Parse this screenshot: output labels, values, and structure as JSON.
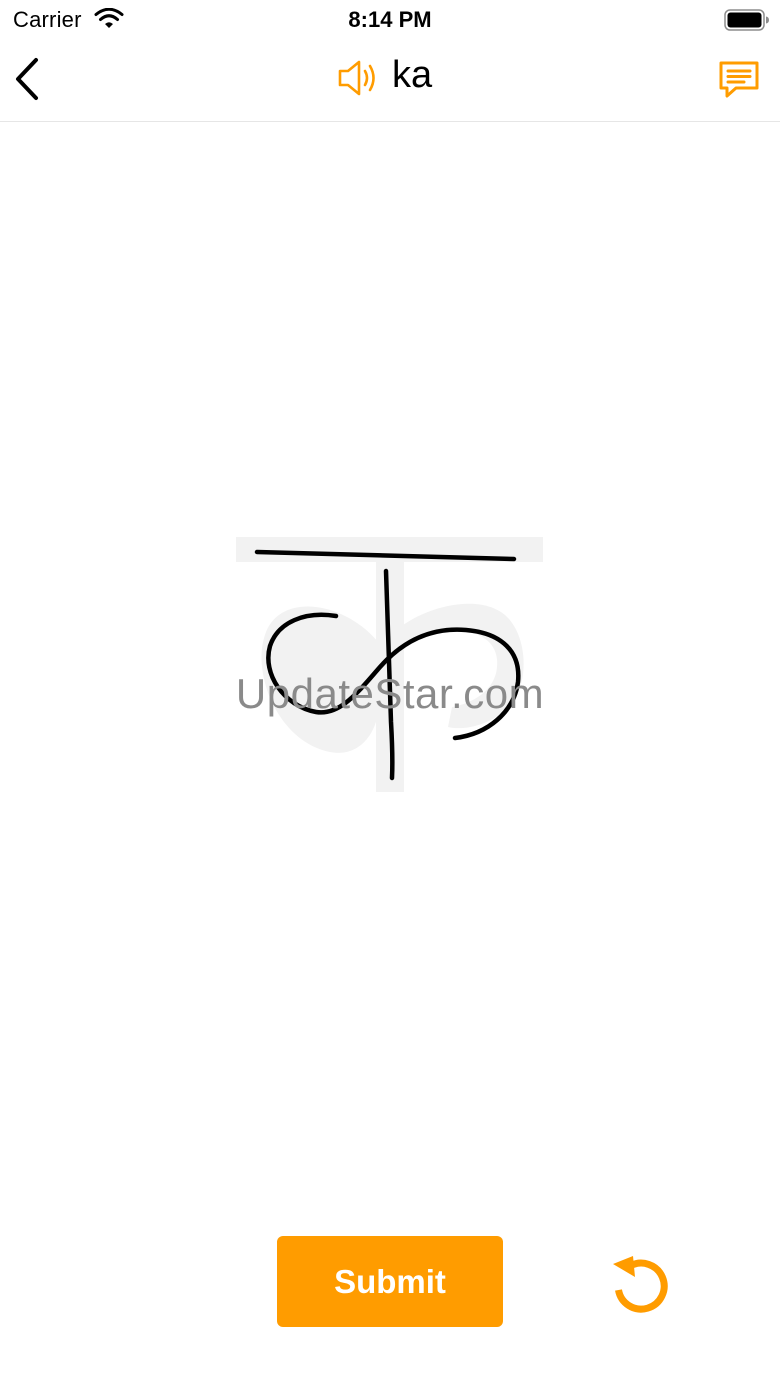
{
  "status_bar": {
    "carrier": "Carrier",
    "time": "8:14 PM"
  },
  "nav": {
    "title": "ka",
    "icons": {
      "back": "chevron-left-icon",
      "speaker": "speaker-icon",
      "comment": "comment-icon"
    }
  },
  "canvas": {
    "guide_letter": "क",
    "watermark": "UpdateStar.com"
  },
  "controls": {
    "submit_label": "Submit",
    "reset_icon": "undo-icon"
  },
  "colors": {
    "accent": "#ff9c00",
    "guide": "#f2f2f2",
    "stroke": "#000000"
  }
}
